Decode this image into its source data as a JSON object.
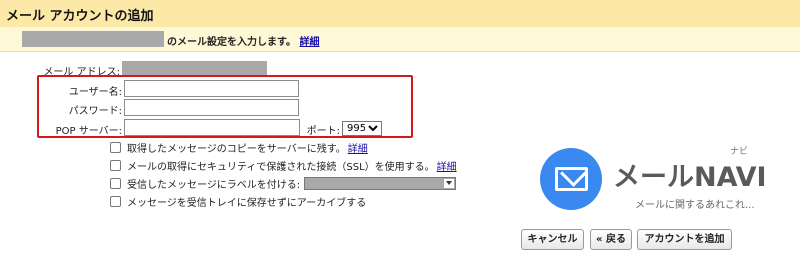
{
  "window": {
    "title": "メール アカウントの追加"
  },
  "instruction": {
    "text": "のメール設定を入力します。",
    "details_link": "詳細"
  },
  "form": {
    "email_label": "メール アドレス:",
    "username_label": "ユーザー名:",
    "password_label": "パスワード:",
    "pop_server_label": "POP サーバー:",
    "port_label": "ポート:",
    "port_value": "995"
  },
  "options": {
    "leave_copy": "取得したメッセージのコピーをサーバーに残す。",
    "leave_copy_link": "詳細",
    "ssl": "メールの取得にセキュリティで保護された接続（SSL）を使用する。",
    "ssl_link": "詳細",
    "label_incoming": "受信したメッセージにラベルを付ける:",
    "archive": "メッセージを受信トレイに保存せずにアーカイブする"
  },
  "logo": {
    "brand": "メールNAVI",
    "ruby": "ナビ",
    "tagline": "メールに関するあれこれ..."
  },
  "buttons": {
    "cancel": "キャンセル",
    "back": "« 戻る",
    "add_account": "アカウントを追加"
  },
  "colors": {
    "title_bar": "#fce9a8",
    "highlight_box": "#d11a1a",
    "logo_circle": "#3a89f0",
    "link": "#1a0dab"
  }
}
